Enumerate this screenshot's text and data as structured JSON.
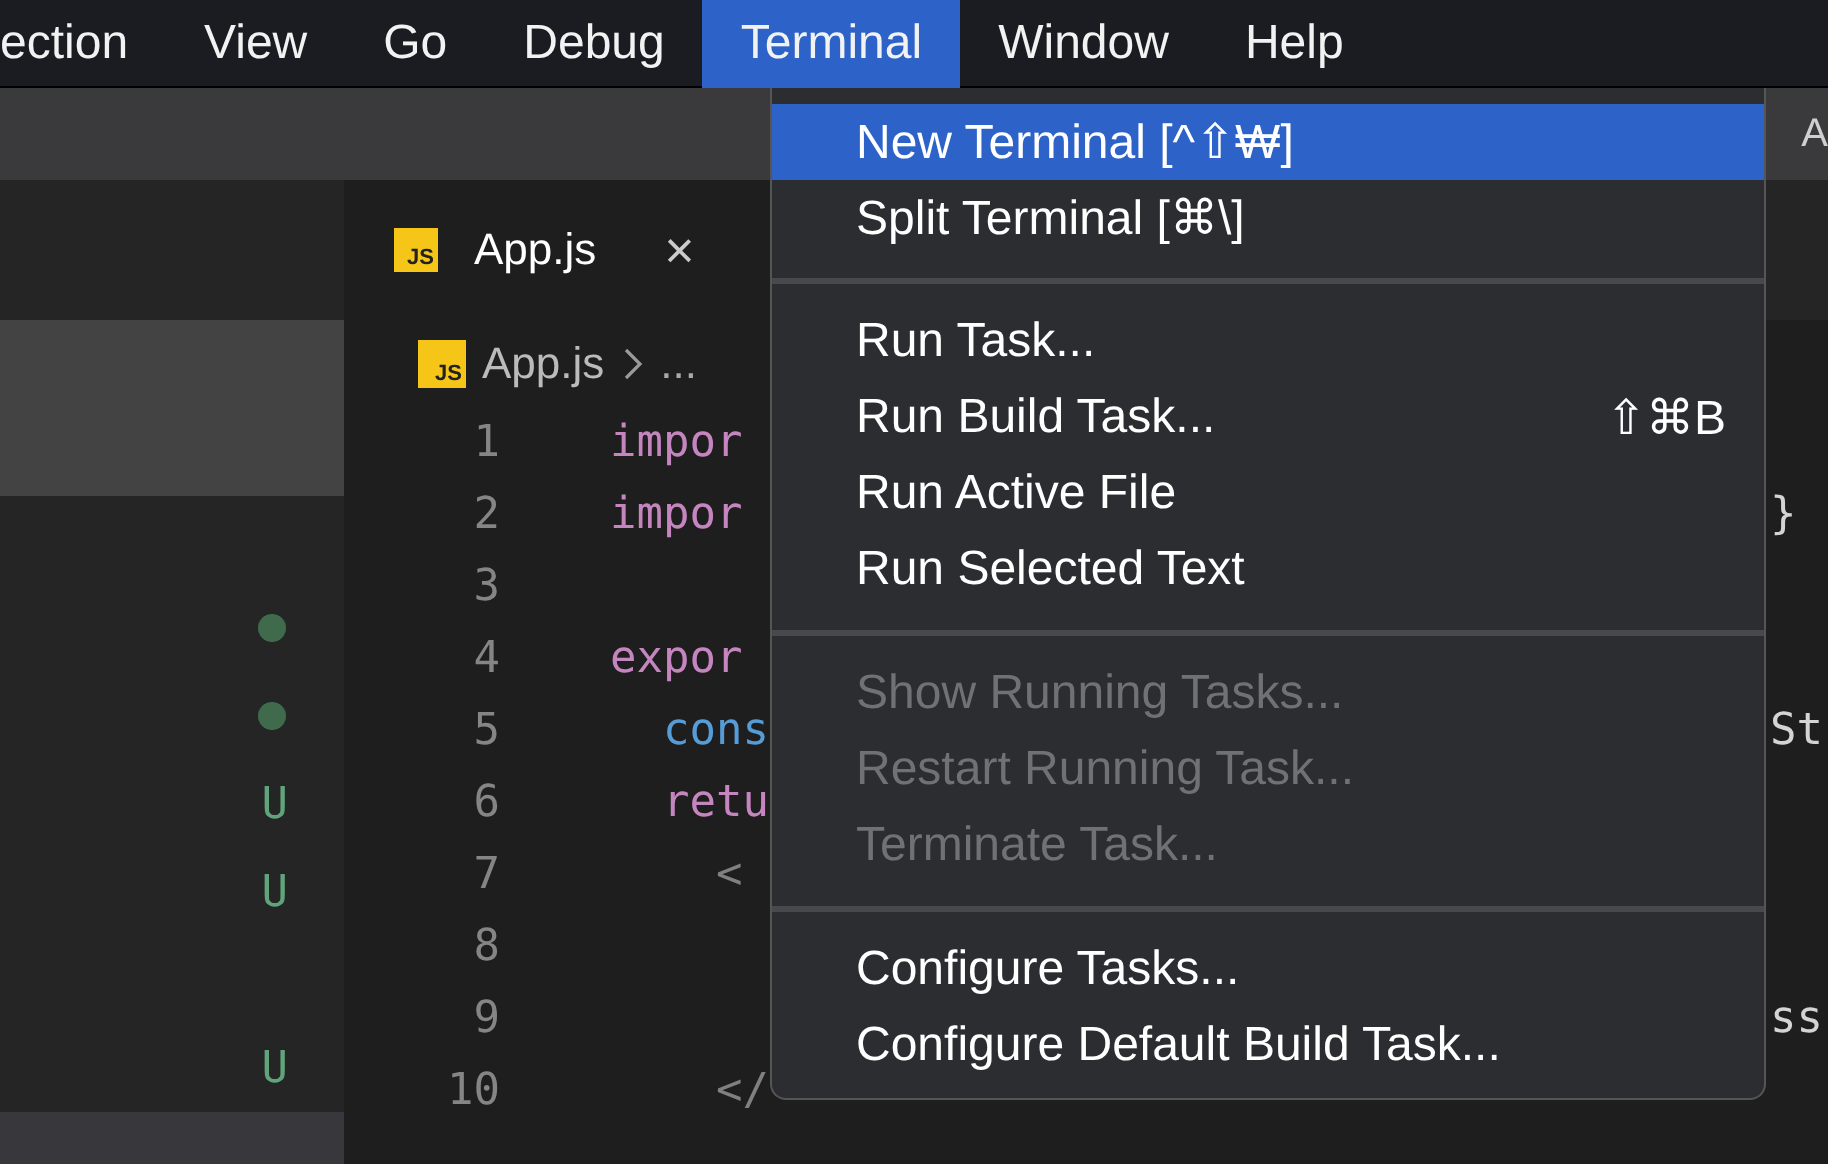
{
  "menubar": [
    {
      "label": "ection",
      "selected": false
    },
    {
      "label": "View",
      "selected": false
    },
    {
      "label": "Go",
      "selected": false
    },
    {
      "label": "Debug",
      "selected": false
    },
    {
      "label": "Terminal",
      "selected": true
    },
    {
      "label": "Window",
      "selected": false
    },
    {
      "label": "Help",
      "selected": false
    }
  ],
  "title_bar": {
    "title": "A"
  },
  "sidebar": {
    "items": [
      {
        "kind": "blank",
        "selected": true
      },
      {
        "kind": "blank",
        "selected": true
      },
      {
        "kind": "blank",
        "selected": false
      },
      {
        "kind": "dot",
        "color": "#3f6b4c",
        "selected": false
      },
      {
        "kind": "dot",
        "color": "#3f6b4c",
        "selected": false
      },
      {
        "kind": "letter",
        "text": "U",
        "selected": false
      },
      {
        "kind": "letter",
        "text": "U",
        "selected": false
      },
      {
        "kind": "blank",
        "selected": false
      },
      {
        "kind": "letter",
        "text": "U",
        "selected": false
      },
      {
        "kind": "blank",
        "selected": true
      }
    ]
  },
  "tabs": [
    {
      "icon": "JS",
      "label": "App.js",
      "close": "×",
      "selected": true
    }
  ],
  "breadcrumb": {
    "icon": "JS",
    "file": "App.js",
    "rest": "..."
  },
  "code": [
    {
      "number": "1",
      "tokens": [
        {
          "text": "impor",
          "kind": "keyword"
        }
      ]
    },
    {
      "number": "2",
      "tokens": [
        {
          "text": "impor",
          "kind": "keyword"
        }
      ],
      "tail": "}"
    },
    {
      "number": "3"
    },
    {
      "number": "4",
      "tokens": [
        {
          "text": "expor",
          "kind": "keyword"
        }
      ]
    },
    {
      "number": "5",
      "tokens": [
        {
          "text": "  cons",
          "kind": "storage"
        }
      ],
      "tail": "St"
    },
    {
      "number": "6",
      "tokens": [
        {
          "text": "  retu",
          "kind": "keyword"
        }
      ]
    },
    {
      "number": "7",
      "tokens": [
        {
          "text": "    <",
          "kind": "punct"
        }
      ]
    },
    {
      "number": "8"
    },
    {
      "number": "9",
      "tail": "ss"
    },
    {
      "number": "10",
      "tokens": [
        {
          "text": "    </",
          "kind": "punct"
        }
      ]
    }
  ],
  "menu": {
    "items": [
      {
        "kind": "item",
        "label": "New Terminal [^⇧₩]",
        "selected": true,
        "disabled": false
      },
      {
        "kind": "item",
        "label": "Split Terminal [⌘\\]",
        "selected": false,
        "disabled": false
      },
      {
        "kind": "separator"
      },
      {
        "kind": "item",
        "label": "Run Task...",
        "selected": false,
        "disabled": false
      },
      {
        "kind": "item",
        "label": "Run Build Task...",
        "shortcut": "⇧⌘B",
        "selected": false,
        "disabled": false
      },
      {
        "kind": "item",
        "label": "Run Active File",
        "selected": false,
        "disabled": false
      },
      {
        "kind": "item",
        "label": "Run Selected Text",
        "selected": false,
        "disabled": false
      },
      {
        "kind": "separator"
      },
      {
        "kind": "item",
        "label": "Show Running Tasks...",
        "selected": false,
        "disabled": true
      },
      {
        "kind": "item",
        "label": "Restart Running Task...",
        "selected": false,
        "disabled": true
      },
      {
        "kind": "item",
        "label": "Terminate Task...",
        "selected": false,
        "disabled": true
      },
      {
        "kind": "separator"
      },
      {
        "kind": "item",
        "label": "Configure Tasks...",
        "selected": false,
        "disabled": false
      },
      {
        "kind": "item",
        "label": "Configure Default Build Task...",
        "selected": false,
        "disabled": false
      }
    ]
  }
}
